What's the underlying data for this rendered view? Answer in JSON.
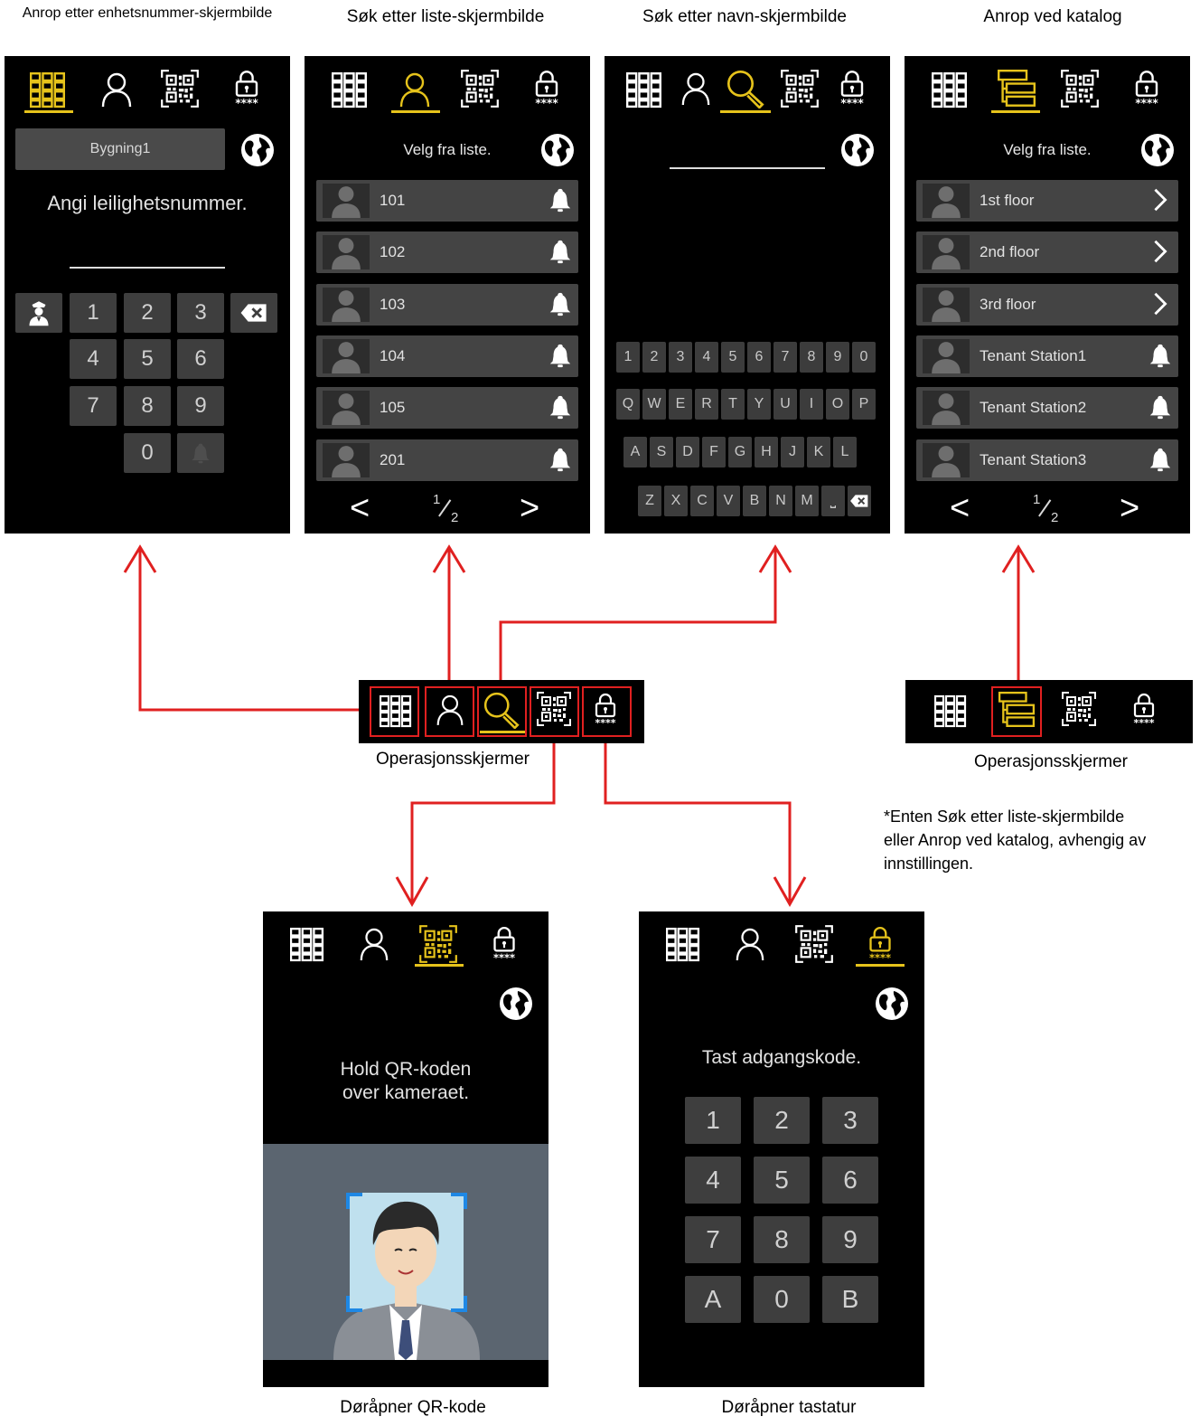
{
  "captions": {
    "unit": "Anrop etter enhetsnummer-skjermbilde",
    "list": "Søk etter liste-skjermbilde",
    "name": "Søk etter navn-skjermbilde",
    "catalog": "Anrop ved katalog",
    "ops1": "Operasjonsskjermer",
    "ops2": "Operasjonsskjermer",
    "qr": "Døråpner QR-kode",
    "keypad": "Døråpner tastatur"
  },
  "note": {
    "line1": "*Enten Søk etter liste-skjermbilde",
    "line2": "eller Anrop ved katalog, avhengig av",
    "line3": "innstillingen."
  },
  "unit_screen": {
    "building": "Bygning1",
    "prompt": "Angi leilighetsnummer.",
    "keys": [
      "1",
      "2",
      "3",
      "4",
      "5",
      "6",
      "7",
      "8",
      "9",
      "0"
    ]
  },
  "list_screen": {
    "prompt": "Velg fra liste.",
    "rows": [
      "101",
      "102",
      "103",
      "104",
      "105",
      "201"
    ],
    "page_current": "1",
    "page_total": "2",
    "prev": "<",
    "next": ">"
  },
  "name_screen": {
    "row_digits": [
      "1",
      "2",
      "3",
      "4",
      "5",
      "6",
      "7",
      "8",
      "9",
      "0"
    ],
    "row_q": [
      "Q",
      "W",
      "E",
      "R",
      "T",
      "Y",
      "U",
      "I",
      "O",
      "P"
    ],
    "row_a": [
      "A",
      "S",
      "D",
      "F",
      "G",
      "H",
      "J",
      "K",
      "L"
    ],
    "row_z": [
      "Z",
      "X",
      "C",
      "V",
      "B",
      "N",
      "M"
    ]
  },
  "catalog_screen": {
    "prompt": "Velg fra liste.",
    "rows": [
      "1st floor",
      "2nd floor",
      "3rd floor",
      "Tenant Station1",
      "Tenant Station2",
      "Tenant Station3"
    ],
    "page_current": "1",
    "page_total": "2",
    "prev": "<",
    "next": ">"
  },
  "qr_screen": {
    "line1": "Hold QR-koden",
    "line2": "over kameraet."
  },
  "keypad_screen": {
    "prompt": "Tast adgangskode.",
    "keys": [
      "1",
      "2",
      "3",
      "4",
      "5",
      "6",
      "7",
      "8",
      "9",
      "A",
      "0",
      "B"
    ]
  },
  "colors": {
    "active": "#e6c31b",
    "arrow": "#e02020",
    "screen": "#000000",
    "key": "#3e3e3e"
  },
  "icons": [
    "grid-keypad-icon",
    "person-icon",
    "search-icon",
    "qr-code-icon",
    "lock-code-icon",
    "globe-icon",
    "bell-icon",
    "chevron-right-icon",
    "backspace-icon",
    "concierge-icon",
    "directory-tree-icon"
  ]
}
